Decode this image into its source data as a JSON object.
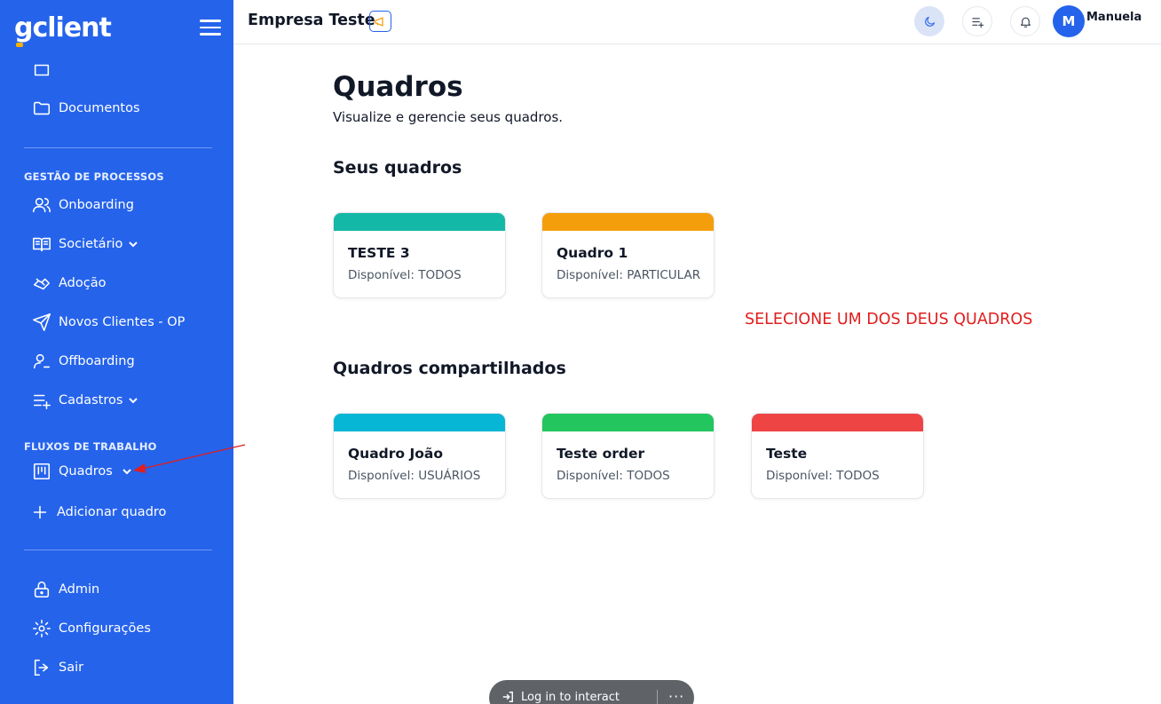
{
  "sidebar": {
    "logo": "gclient",
    "nav_top": [
      {
        "label": "Documentos",
        "icon": "folder-icon"
      }
    ],
    "section_processos": "GESTÃO DE PROCESSOS",
    "processos": [
      {
        "label": "Onboarding",
        "icon": "users-icon"
      },
      {
        "label": "Societário",
        "icon": "book-open-icon",
        "expandable": true
      },
      {
        "label": "Adoção",
        "icon": "handshake-icon"
      },
      {
        "label": "Novos Clientes - OP",
        "icon": "send-icon"
      },
      {
        "label": "Offboarding",
        "icon": "user-minus-icon"
      },
      {
        "label": "Cadastros",
        "icon": "list-plus-icon",
        "expandable": true
      }
    ],
    "section_fluxos": "FLUXOS DE TRABALHO",
    "fluxos": [
      {
        "label": "Quadros",
        "icon": "kanban-icon",
        "expandable": true
      },
      {
        "label": "Adicionar quadro",
        "icon": "plus-icon"
      }
    ],
    "bottom": [
      {
        "label": "Admin",
        "icon": "lock-icon"
      },
      {
        "label": "Configurações",
        "icon": "gear-icon"
      },
      {
        "label": "Sair",
        "icon": "logout-icon"
      }
    ]
  },
  "topbar": {
    "company": "Empresa Teste",
    "avatar_initial": "M",
    "username": "Manuela"
  },
  "main": {
    "title": "Quadros",
    "subtitle": "Visualize e gerencie seus quadros.",
    "own_section": "Seus quadros",
    "own_boards": [
      {
        "name": "TESTE 3",
        "availability": "Disponível: TODOS",
        "color": "#14b8a6"
      },
      {
        "name": "Quadro 1",
        "availability": "Disponível: PARTICULAR",
        "color": "#f59e0b"
      }
    ],
    "shared_section": "Quadros compartilhados",
    "shared_boards": [
      {
        "name": "Quadro João",
        "availability": "Disponível: USUÁRIOS",
        "color": "#06b6d4"
      },
      {
        "name": "Teste order",
        "availability": "Disponível: TODOS",
        "color": "#22c55e"
      },
      {
        "name": "Teste",
        "availability": "Disponível: TODOS",
        "color": "#ef4444"
      }
    ]
  },
  "annotation": "SELECIONE UM DOS DEUS QUADROS",
  "login_pill": {
    "label": "Log in to interact",
    "more": "···"
  },
  "colors": {
    "sidebar": "#2563eb",
    "annotation": "#e11d1d"
  }
}
